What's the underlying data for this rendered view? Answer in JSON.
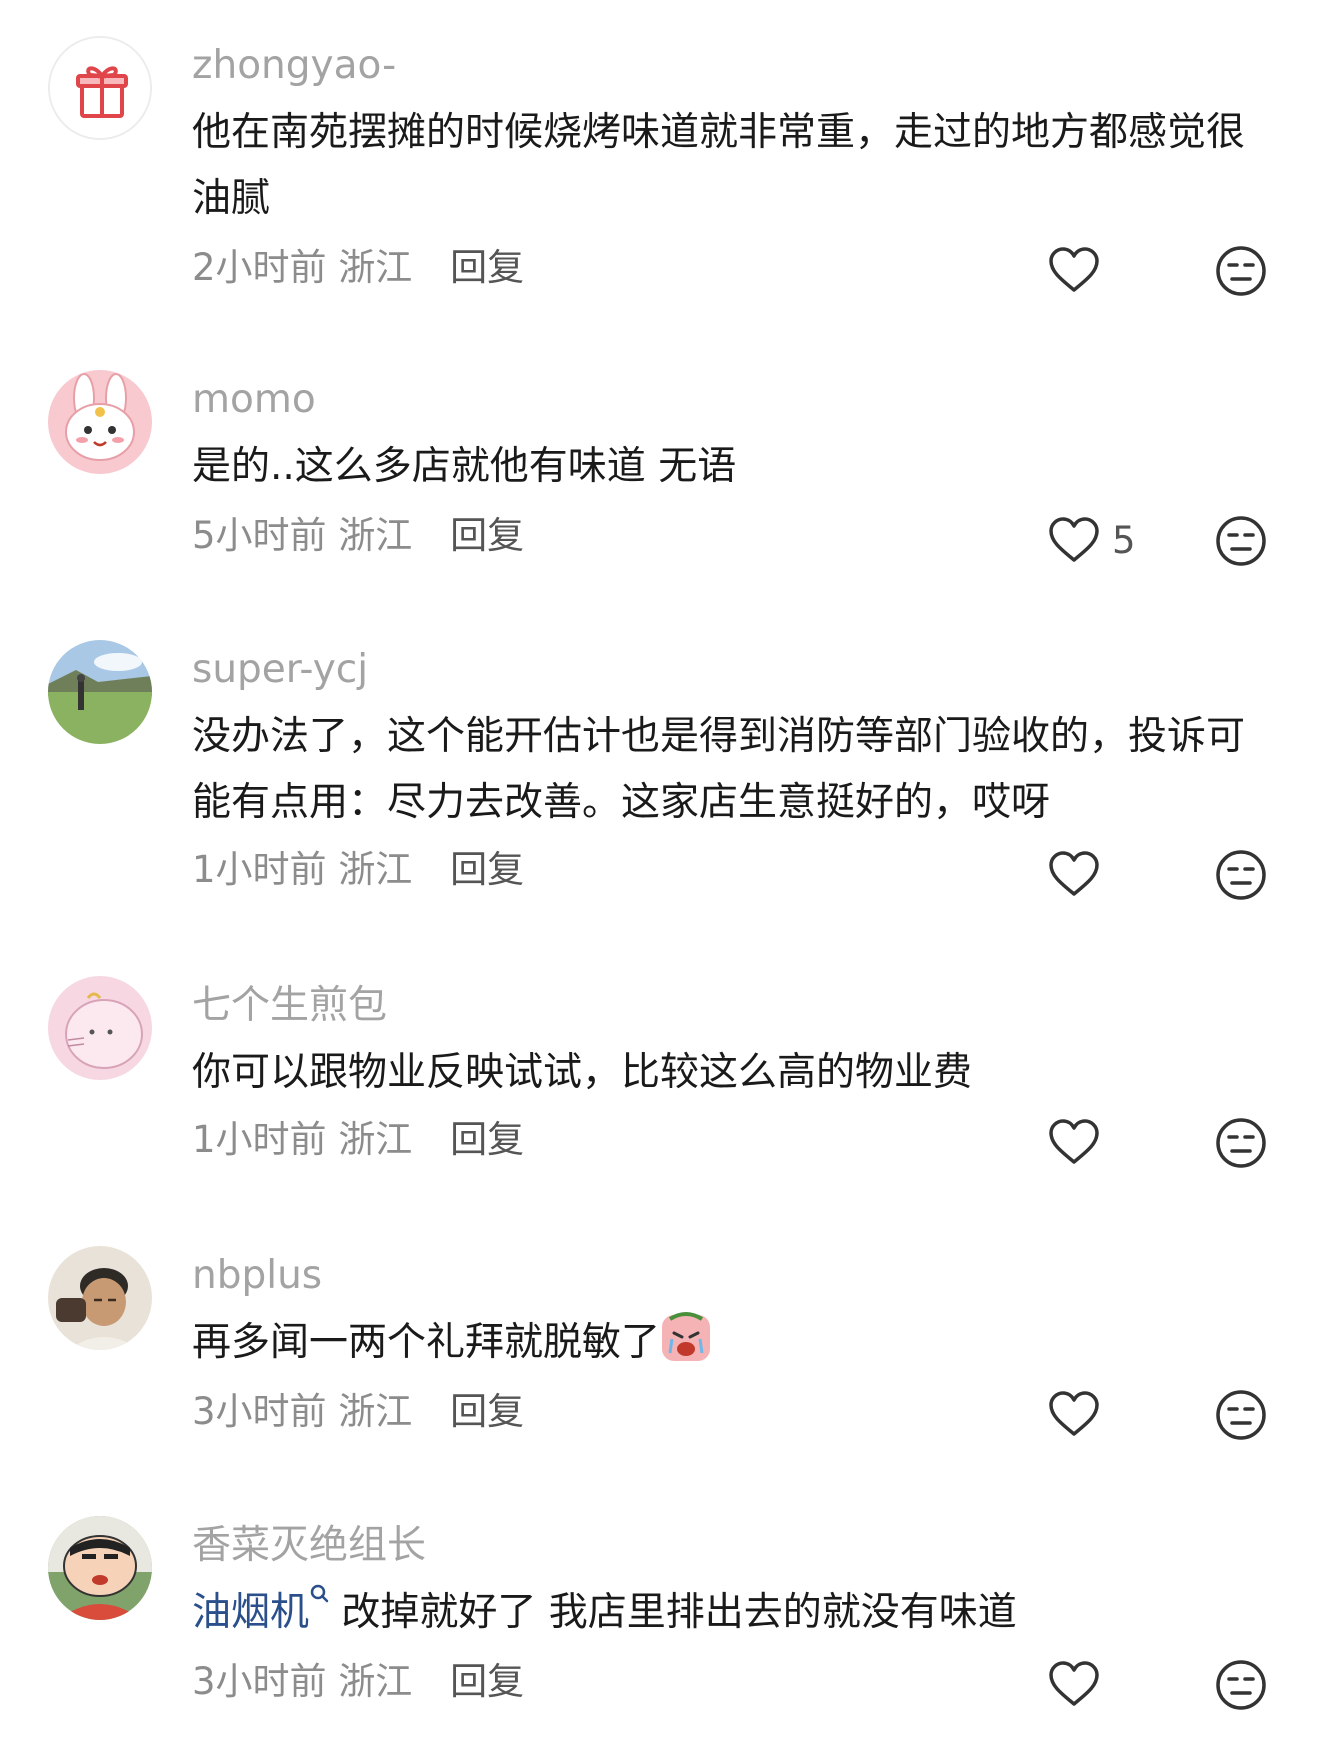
{
  "comments": [
    {
      "username": "zhongyao-",
      "avatar_icon": "gift-icon",
      "text": "他在南苑摆摊的时候烧烤味道就非常重，走过的地方都感觉很油腻",
      "time": "2小时前",
      "location": "浙江",
      "reply_label": "回复",
      "likes": ""
    },
    {
      "username": "momo",
      "avatar_icon": "bunny-avatar",
      "text": "是的..这么多店就他有味道 无语",
      "time": "5小时前",
      "location": "浙江",
      "reply_label": "回复",
      "likes": "5"
    },
    {
      "username": "super-ycj",
      "avatar_icon": "landscape-avatar",
      "text": "没办法了，这个能开估计也是得到消防等部门验收的，投诉可能有点用：尽力去改善。这家店生意挺好的，哎呀",
      "time": "1小时前",
      "location": "浙江",
      "reply_label": "回复",
      "likes": ""
    },
    {
      "username": "七个生煎包",
      "avatar_icon": "cartoon-cat-avatar",
      "text": "你可以跟物业反映试试，比较这么高的物业费",
      "time": "1小时前",
      "location": "浙江",
      "reply_label": "回复",
      "likes": ""
    },
    {
      "username": "nbplus",
      "avatar_icon": "man-photo-avatar",
      "text": "再多闻一两个礼拜就脱敏了",
      "emoji": "crying-emoji",
      "time": "3小时前",
      "location": "浙江",
      "reply_label": "回复",
      "likes": ""
    },
    {
      "username": "香菜灭绝组长",
      "avatar_icon": "crayon-shin-avatar",
      "link_text": "油烟机",
      "link_icon": "search-icon",
      "text": " 改掉就好了 我店里排出去的就没有味道",
      "time": "3小时前",
      "location": "浙江",
      "reply_label": "回复",
      "likes": ""
    }
  ],
  "colors": {
    "username": "#a3a3a3",
    "text": "#1a1a1a",
    "meta": "#8c8c8c",
    "link": "#2a4f8a",
    "icon": "#333333"
  }
}
